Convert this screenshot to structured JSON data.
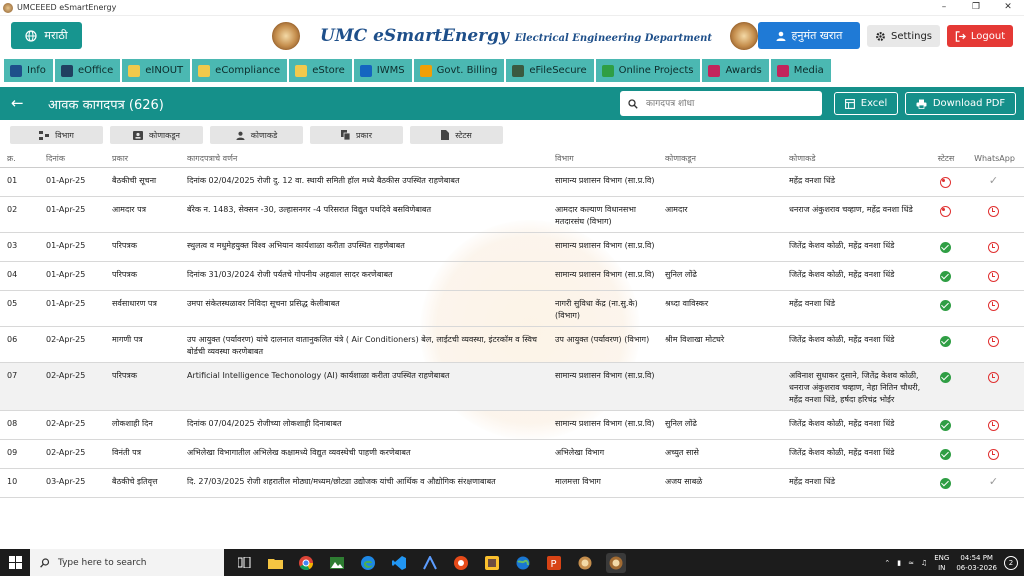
{
  "window": {
    "title": "UMCEEED eSmartEnergy",
    "controls": {
      "minimize": "–",
      "maximize": "❐",
      "close": "✕"
    }
  },
  "header": {
    "lang_label": "मराठी",
    "brand": "UMC eSmartEnergy",
    "department": "Electrical Engineering Department",
    "user_label": "हनुमंत खरात",
    "settings_label": "Settings",
    "logout_label": "Logout"
  },
  "modules": [
    {
      "label": "Info",
      "icon": "info-icon",
      "color": "#1e4f8a"
    },
    {
      "label": "eOffice",
      "icon": "office-icon",
      "color": "#204060"
    },
    {
      "label": "eINOUT",
      "icon": "inout-icon",
      "color": "#f2c94c"
    },
    {
      "label": "eCompliance",
      "icon": "compliance-icon",
      "color": "#f2c94c"
    },
    {
      "label": "eStore",
      "icon": "store-icon",
      "color": "#f2c94c"
    },
    {
      "label": "IWMS",
      "icon": "iwms-icon",
      "color": "#1565c0"
    },
    {
      "label": "Govt. Billing",
      "icon": "billing-icon",
      "color": "#f29f05"
    },
    {
      "label": "eFileSecure",
      "icon": "file-secure-icon",
      "color": "#3a5a40"
    },
    {
      "label": "Online Projects",
      "icon": "projects-icon",
      "color": "#2f9e44"
    },
    {
      "label": "Awards",
      "icon": "awards-icon",
      "color": "#c2255c"
    },
    {
      "label": "Media",
      "icon": "media-icon",
      "color": "#c2255c"
    }
  ],
  "page": {
    "title": "आवक कागदपत्र (626)",
    "search_placeholder": "कागदपत्र शोधा",
    "excel_label": "Excel",
    "pdf_label": "Download PDF"
  },
  "filters": [
    "विभाग",
    "कोणाकडून",
    "कोणाकडे",
    "प्रकार",
    "स्टेटस"
  ],
  "table": {
    "headers": [
      "क्र.",
      "दिनांक",
      "प्रकार",
      "कागदपत्राचे वर्णन",
      "विभाग",
      "कोणाकडून",
      "कोणाकडे",
      "स्टेटस",
      "WhatsApp"
    ],
    "rows": [
      {
        "no": "01",
        "date": "01-Apr-25",
        "type": "बैठकीची सूचना",
        "desc": "दिनांक 02/04/2025 रोजी दु. 12 वा. स्थायी समिती हॉल मध्ये बैठकीस उपस्थित राहणेबाबत",
        "dept": "सामान्य प्रशासन विभाग (सा.प्र.वि)",
        "from": "",
        "to": "महेंद्र वनशा धिंडे",
        "status": "pending",
        "wa": "sent"
      },
      {
        "no": "02",
        "date": "01-Apr-25",
        "type": "आमदार पत्र",
        "desc": "बॅरेक न. 1483, सेक्सन -30, उल्हासनगर -4 परिसरात विद्युत पथदिवे बसविणेबाबत",
        "dept": "आमदार कल्याण विधानसभा मतदारसंघ (विभाग)",
        "from": "आमदार",
        "to": "धनराज अंकुशराव चव्हाण, महेंद्र वनशा धिंडे",
        "status": "pending",
        "wa": "clock"
      },
      {
        "no": "03",
        "date": "01-Apr-25",
        "type": "परिपत्रक",
        "desc": "स्थुलत्व व मधुमेहयुक्त विश्व अभियान कार्यशाळा करीता उपस्थित राहणेबाबत",
        "dept": "सामान्य प्रशासन विभाग (सा.प्र.वि)",
        "from": "",
        "to": "जितेंद्र केशव कोळी, महेंद्र वनशा धिंडे",
        "status": "ok",
        "wa": "clock"
      },
      {
        "no": "04",
        "date": "01-Apr-25",
        "type": "परिपत्रक",
        "desc": "दिनांक 31/03/2024 रोजी पर्यतचे गोपनीय अहवाल सादर करणेबाबत",
        "dept": "सामान्य प्रशासन विभाग (सा.प्र.वि)",
        "from": "सुनिल लोंढे",
        "to": "जितेंद्र केशव कोळी, महेंद्र वनशा धिंडे",
        "status": "ok",
        "wa": "clock"
      },
      {
        "no": "05",
        "date": "01-Apr-25",
        "type": "सर्वसाधारण पत्र",
        "desc": "उमपा संकेतस्थळावर निविदा सूचना प्रसिद्ध केलीबाबत",
        "dept": "नागरी सुविधा केंद्र (ना.सु.के) (विभाग)",
        "from": "श्रध्दा वाविस्कर",
        "to": "महेंद्र वनशा धिंडे",
        "status": "ok",
        "wa": "clock"
      },
      {
        "no": "06",
        "date": "02-Apr-25",
        "type": "मागणी पत्र",
        "desc": "उप आयुक्त (पर्यावरण) यांचे दालनात वातानुकलित यंत्रे ( Air Conditioners) बेल, लाईटची व्यवस्था, इंटरकॉम व स्विच बोर्डची व्यवस्था करणेबाबत",
        "dept": "उप आयुक्त (पर्यावरण) (विभाग)",
        "from": "श्रीम विशाखा मोटघरे",
        "to": "जितेंद्र केशव कोळी, महेंद्र वनशा धिंडे",
        "status": "ok",
        "wa": "clock"
      },
      {
        "no": "07",
        "date": "02-Apr-25",
        "type": "परिपत्रक",
        "desc": "Artificial Intelligence Techonology (AI) कार्यशाळा करीता उपस्थित राहणेबाबत",
        "dept": "सामान्य प्रशासन विभाग (सा.प्र.वि)",
        "from": "",
        "to": "अविनाश सुधाकर दुसाने, जितेंद्र केशव कोळी, धनराज अंकुशराव चव्हाण, नेहा नितिन चौधरी, महेंद्र वनशा धिंडे, हर्षदा हरिचंद्र भोईर",
        "status": "ok",
        "wa": "clock"
      },
      {
        "no": "08",
        "date": "02-Apr-25",
        "type": "लोकशाही दिन",
        "desc": "दिनांक 07/04/2025 रोजीच्या लोकशाही दिनाबाबत",
        "dept": "सामान्य प्रशासन विभाग (सा.प्र.वि)",
        "from": "सुनिल लोंढे",
        "to": "जितेंद्र केशव कोळी, महेंद्र वनशा धिंडे",
        "status": "ok",
        "wa": "clock"
      },
      {
        "no": "09",
        "date": "02-Apr-25",
        "type": "विनंती पत्र",
        "desc": "अभिलेखा विभागातील अभिलेख कक्षामध्ये विद्युत व्यवस्थेची पाहणी करणेबाबत",
        "dept": "अभिलेखा विभाग",
        "from": "अच्युत सासे",
        "to": "जितेंद्र केशव कोळी, महेंद्र वनशा धिंडे",
        "status": "ok",
        "wa": "clock"
      },
      {
        "no": "10",
        "date": "03-Apr-25",
        "type": "बैठकीचे इतिवृत्त",
        "desc": "दि. 27/03/2025 रोजी शहरातील मोठ्या/मध्यम/छोट्या उद्योजक यांची आर्थिक व औद्योगिक संरक्षणाबाबत",
        "dept": "मालमत्ता विभाग",
        "from": "अजय साबळे",
        "to": "महेंद्र वनशा धिंडे",
        "status": "ok",
        "wa": "sent"
      }
    ]
  },
  "taskbar": {
    "search_placeholder": "Type here to search",
    "lang": "ENG",
    "region": "IN",
    "time": "04:54 PM",
    "date": "06-03-2026",
    "notifications": "2"
  }
}
